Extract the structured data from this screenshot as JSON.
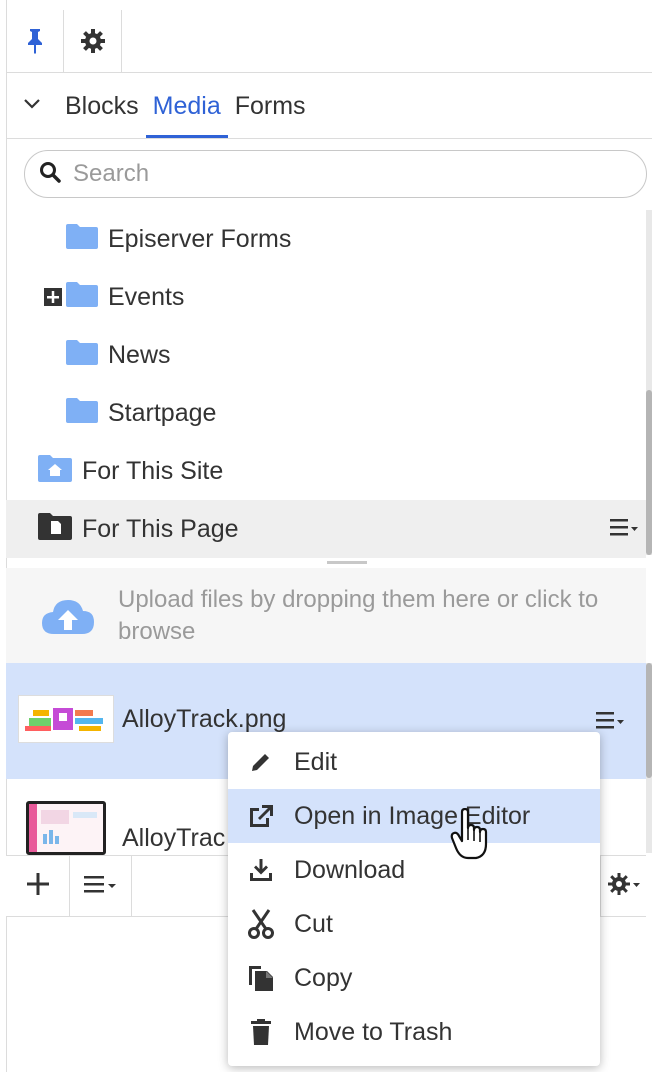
{
  "colors": {
    "accent": "#2f62d6",
    "selected_bg": "#d4e2fb",
    "folder": "#7fb0f5",
    "muted_text": "#9a9a9a"
  },
  "toolbar": {
    "pin_icon": "pin-icon",
    "settings_icon": "gear-icon"
  },
  "tabs": [
    {
      "label": "Blocks",
      "active": false
    },
    {
      "label": "Media",
      "active": true
    },
    {
      "label": "Forms",
      "active": false
    }
  ],
  "search": {
    "placeholder": "Search",
    "value": ""
  },
  "tree": {
    "items": [
      {
        "label": "Episerver Forms",
        "icon": "folder-icon"
      },
      {
        "label": "Events",
        "icon": "folder-icon",
        "expandable": true
      },
      {
        "label": "News",
        "icon": "folder-icon"
      },
      {
        "label": "Startpage",
        "icon": "folder-icon"
      },
      {
        "label": "For This Site",
        "icon": "site-folder-icon"
      },
      {
        "label": "For This Page",
        "icon": "page-folder-icon",
        "highlighted": true
      }
    ]
  },
  "dropzone": {
    "text": "Upload files by dropping them here or click to browse"
  },
  "media": {
    "items": [
      {
        "name": "AlloyTrack.png",
        "selected": true
      },
      {
        "name": "AlloyTrac",
        "selected": false
      }
    ]
  },
  "context_menu": {
    "items": [
      {
        "label": "Edit",
        "icon": "pencil-icon",
        "hover": false
      },
      {
        "label": "Open in Image Editor",
        "icon": "external-link-icon",
        "hover": true
      },
      {
        "label": "Download",
        "icon": "download-icon",
        "hover": false
      },
      {
        "label": "Cut",
        "icon": "scissors-icon",
        "hover": false
      },
      {
        "label": "Copy",
        "icon": "copy-icon",
        "hover": false
      },
      {
        "label": "Move to Trash",
        "icon": "trash-icon",
        "hover": false
      }
    ]
  }
}
